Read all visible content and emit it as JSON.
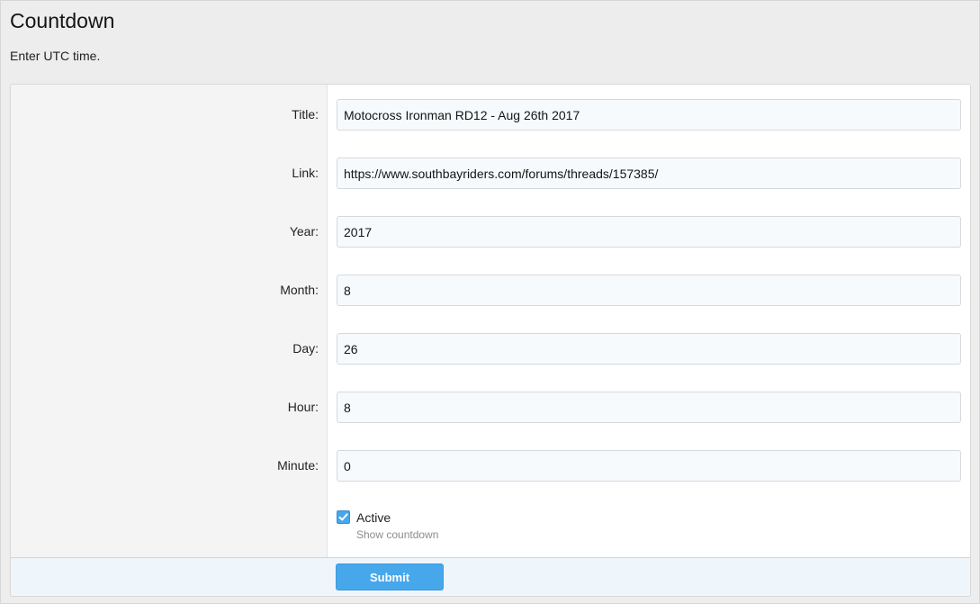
{
  "page": {
    "title": "Countdown",
    "description": "Enter UTC time."
  },
  "form": {
    "fields": [
      {
        "key": "title",
        "label": "Title:",
        "value": "Motocross Ironman RD12 - Aug 26th 2017"
      },
      {
        "key": "link",
        "label": "Link:",
        "value": "https://www.southbayriders.com/forums/threads/157385/"
      },
      {
        "key": "year",
        "label": "Year:",
        "value": "2017"
      },
      {
        "key": "month",
        "label": "Month:",
        "value": "8"
      },
      {
        "key": "day",
        "label": "Day:",
        "value": "26"
      },
      {
        "key": "hour",
        "label": "Hour:",
        "value": "8"
      },
      {
        "key": "minute",
        "label": "Minute:",
        "value": "0"
      }
    ],
    "active": {
      "label": "Active",
      "hint": "Show countdown",
      "checked": true
    },
    "submit_label": "Submit"
  },
  "colors": {
    "accent": "#47a7eb",
    "page_bg": "#ededed",
    "label_col_bg": "#f4f4f4",
    "submit_bar_bg": "#eef5fb"
  },
  "icons": {
    "checkbox": "checkmark-icon"
  }
}
